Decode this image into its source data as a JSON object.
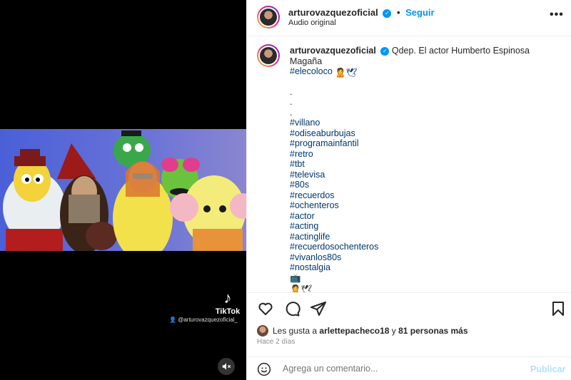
{
  "media": {
    "tiktok_label": "TikTok",
    "tiktok_user": "@arturovazquezoficial_",
    "mute_icon": "speaker-muted-icon"
  },
  "header": {
    "username": "arturovazquezoficial",
    "follow_label": "Seguir",
    "audio": "Audio original",
    "more_icon": "ellipsis-icon"
  },
  "caption": {
    "username": "arturovazquezoficial",
    "text": "Qdep. El actor Humberto Espinosa Magaña",
    "first_tag": "#elecoloco",
    "dots": [
      ".",
      ".",
      "."
    ],
    "tags": [
      "#villano",
      "#odiseaburbujas",
      "#programainfantil",
      "#retro",
      "#tbt",
      "#televisa",
      "#80s",
      "#recuerdos",
      "#ochenteros",
      "#actor",
      "#acting",
      "#actinglife",
      "#recuerdosochenteros",
      "#vivanlos80s",
      "#nostalgia"
    ]
  },
  "likes": {
    "prefix": "Les gusta a ",
    "user": "arlettepacheco18",
    "middle": " y ",
    "others": "81 personas más"
  },
  "time": "Hace 2 días",
  "comment": {
    "placeholder": "Agrega un comentario...",
    "publish": "Publicar"
  },
  "colors": {
    "link": "#00376b",
    "accent": "#0095f6",
    "publish_disabled": "#b2dffc"
  }
}
